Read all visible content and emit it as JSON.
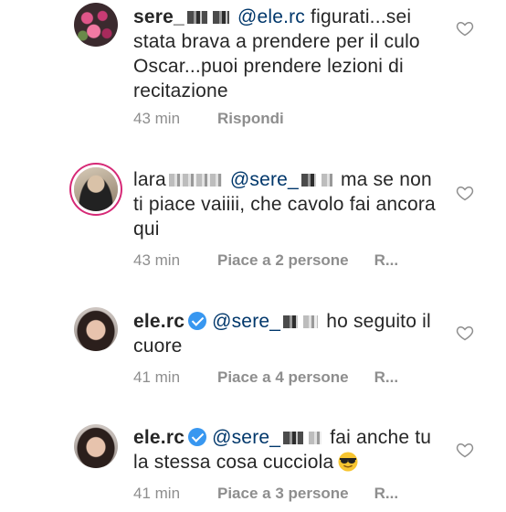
{
  "comments": [
    {
      "username": "sere_",
      "mention": "@ele.rc",
      "text": " figurati...sei stata brava a prendere per il culo Oscar...puoi prendere lezioni di recitazione",
      "time": "43 min",
      "actions": [
        "Rispondi"
      ]
    },
    {
      "username": "lara",
      "mention": "@sere_",
      "text": " ma se non ti piace vaiiii, che cavolo fai ancora qui",
      "time": "43 min",
      "actions": [
        "Piace a 2 persone",
        "R..."
      ]
    },
    {
      "username": "ele.rc",
      "mention": "@sere_",
      "text": " ho seguito il cuore",
      "time": "41 min",
      "actions": [
        "Piace a 4 persone",
        "R..."
      ]
    },
    {
      "username": "ele.rc",
      "mention": "@sere_",
      "text": " fai anche tu la stessa cosa cucciola",
      "time": "41 min",
      "actions": [
        "Piace a 3 persone",
        "R..."
      ]
    }
  ],
  "colors": {
    "mention": "#00376b",
    "verified": "#3897f0",
    "meta": "#8e8e8e"
  },
  "icons": {
    "like": "heart-outline-icon",
    "verified": "verified-badge-icon",
    "emoji": "sunglasses-emoji-icon"
  }
}
